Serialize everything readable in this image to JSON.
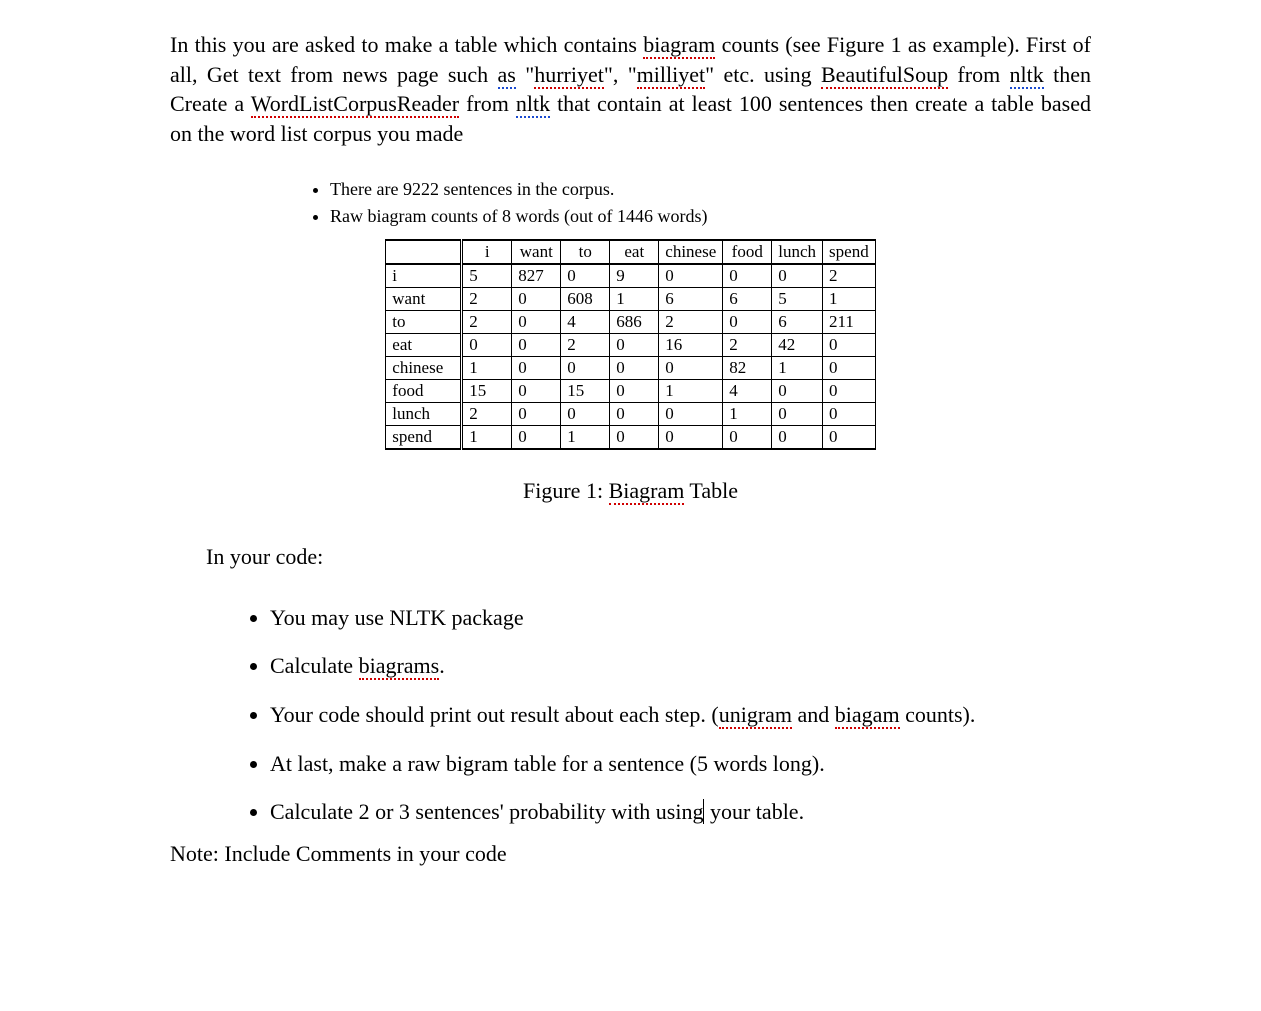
{
  "intro": {
    "p": "In this you are asked to make a table which contains biagram counts (see Figure 1 as example). First of all, Get text from news page such as \"hurriyet\", \"milliyet\" etc. using BeautifulSoup from nltk then Create a WordListCorpusReader from nltk that contain at least 100 sentences then create a table based on the word list corpus you made",
    "spell_words_red": [
      "biagram",
      "hurriyet",
      "milliyet",
      "BeautifulSoup",
      "WordListCorpusReader"
    ],
    "spell_words_blue": [
      "nltk",
      "nltk",
      "nltk"
    ]
  },
  "small_bullets": [
    "There are 9222 sentences in the corpus.",
    "Raw biagram counts of 8 words (out of 1446 words)"
  ],
  "chart_data": {
    "type": "table",
    "columns": [
      "i",
      "want",
      "to",
      "eat",
      "chinese",
      "food",
      "lunch",
      "spend"
    ],
    "rows": [
      "i",
      "want",
      "to",
      "eat",
      "chinese",
      "food",
      "lunch",
      "spend"
    ],
    "values": [
      [
        5,
        827,
        0,
        9,
        0,
        0,
        0,
        2
      ],
      [
        2,
        0,
        608,
        1,
        6,
        6,
        5,
        1
      ],
      [
        2,
        0,
        4,
        686,
        2,
        0,
        6,
        211
      ],
      [
        0,
        0,
        2,
        0,
        16,
        2,
        42,
        0
      ],
      [
        1,
        0,
        0,
        0,
        0,
        82,
        1,
        0
      ],
      [
        15,
        0,
        15,
        0,
        1,
        4,
        0,
        0
      ],
      [
        2,
        0,
        0,
        0,
        0,
        1,
        0,
        0
      ],
      [
        1,
        0,
        1,
        0,
        0,
        0,
        0,
        0
      ]
    ]
  },
  "figure_caption_prefix": "Figure 1: ",
  "figure_caption_word": "Biagram",
  "figure_caption_suffix": " Table",
  "section_label": "In your code:",
  "big_bullets": {
    "b1": "You may use NLTK package",
    "b2_prefix": "Calculate ",
    "b2_word": "biagrams",
    "b2_suffix": ".",
    "b3_prefix": "Your code should print out result about each step. (",
    "b3_w1": "unigram",
    "b3_mid": " and ",
    "b3_w2": "biagam",
    "b3_suffix": " counts).",
    "b4": "At last, make a raw bigram table for a sentence (5 words long).",
    "b5_prefix": "Calculate 2 or 3 sentences' probability with using",
    "b5_suffix": " your table."
  },
  "note": "Note: Include Comments in your code"
}
